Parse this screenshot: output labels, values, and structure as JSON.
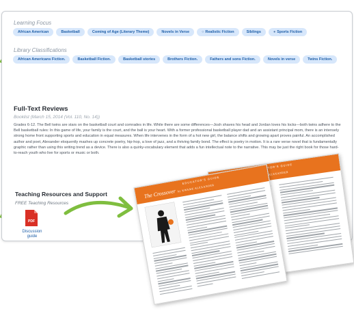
{
  "learning_focus": {
    "label": "Learning Focus",
    "chips": [
      {
        "text": "African American",
        "prefix": ""
      },
      {
        "text": "Basketball",
        "prefix": ""
      },
      {
        "text": "Coming of Age (Literary Theme)",
        "prefix": ""
      },
      {
        "text": "Novels in Verse",
        "prefix": ""
      },
      {
        "text": "Realistic Fiction",
        "prefix": "○"
      },
      {
        "text": "Siblings",
        "prefix": ""
      },
      {
        "text": "Sports Fiction",
        "prefix": "●"
      }
    ]
  },
  "library_classifications": {
    "label": "Library Classifications",
    "chips": [
      {
        "text": "African Americans Fiction."
      },
      {
        "text": "Basketball Fiction."
      },
      {
        "text": "Basketball stories"
      },
      {
        "text": "Brothers Fiction."
      },
      {
        "text": "Fathers and sons Fiction."
      },
      {
        "text": "Novels in verse"
      },
      {
        "text": "Twins Fiction."
      }
    ]
  },
  "full_text_reviews": {
    "title": "Full-Text Reviews",
    "source": "Booklist (March 15, 2014 (Vol. 110, No. 14))",
    "body": "Grades 6-12. The Bell twins are stars on the basketball court and comrades in life. While there are some differences—Josh shaves his head and Jordan loves his locks—both twins adhere to the Bell basketball rules: In this game of life, your family is the court, and the ball is your heart. With a former professional basketball player dad and an assistant principal mom, there is an intensely strong home front supporting sports and education in equal measures. When life intervenes in the form of a hot new girl, the balance shifts and growing apart proves painful. An accomplished author and poet, Alexander eloquently mashes up concrete poetry, hip-hop, a love of jazz, and a thriving family bond. The effect is poetry in motion. It is a rare verse novel that is fundamentally graphic rather than using this writing trend as a device. There is also a quirky-vocabulary element that adds a fun intellectual note to the narrative. This may be just the right book for those hard-to-reach youth who live for sports or music or both."
  },
  "teaching_resources": {
    "title": "Teaching Resources and Support",
    "subtitle": "FREE Teaching Resources",
    "pdf_icon_text": "PDF",
    "link_label": "Discussion guide"
  },
  "guide_pages": {
    "caption": "EDUCATOR'S GUIDE",
    "title": "The Crossover",
    "author": "by KWAME ALEXANDER"
  },
  "colors": {
    "chip_bg": "#d7e7fb",
    "chip_text": "#1f5fa8",
    "arrow": "#7fbe3f",
    "pdf_red": "#d93025",
    "guide_orange": "#e8731e"
  }
}
